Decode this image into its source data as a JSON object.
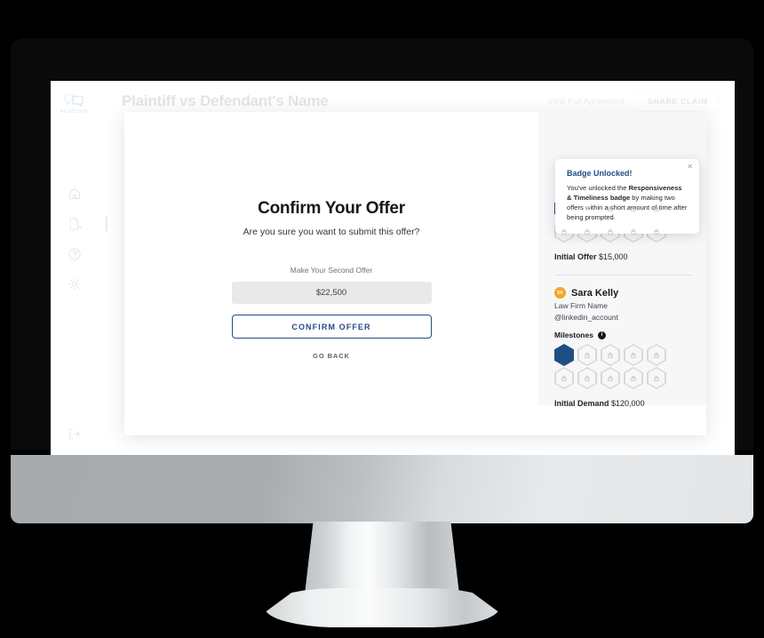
{
  "app": {
    "logo_text": "RESOLUTN",
    "logo_icon": "speech-bubbles-icon",
    "nav_arrows": "← →",
    "header": {
      "title": "Plaintiff vs Defendant's Name",
      "view_agreement_label": "View Full Agreement",
      "share_claim_label": "SHARE CLAIM"
    },
    "sidebar_items": [
      {
        "name": "home",
        "icon": "home-icon",
        "active": false
      },
      {
        "name": "new-claim",
        "icon": "document-add-icon",
        "active": true
      },
      {
        "name": "help",
        "icon": "help-circle-icon",
        "active": false
      },
      {
        "name": "settings",
        "icon": "gear-icon",
        "active": false
      }
    ],
    "logout_icon": "logout-icon"
  },
  "modal": {
    "close_icon": "close-icon",
    "title": "Confirm Your Offer",
    "subtitle": "Are you sure you want to submit this offer?",
    "offer_label": "Make Your Second Offer",
    "offer_value": "$22,500",
    "confirm_label": "CONFIRM OFFER",
    "go_back_label": "GO BACK"
  },
  "toast": {
    "close_icon": "close-icon",
    "title": "Badge Unlocked!",
    "body_prefix": "You've unlocked the ",
    "body_badge": "Responsiveness & Timeliness badge",
    "body_suffix": " by making two offers within a short amount of time after being prompted."
  },
  "side_panel": {
    "defendant": {
      "badges": [
        {
          "state": "filled",
          "icon": "upload-icon"
        },
        {
          "state": "filled",
          "icon": "clock-icon"
        },
        {
          "state": "locked",
          "icon": "lock-icon"
        },
        {
          "state": "locked",
          "icon": "lock-icon"
        },
        {
          "state": "locked",
          "icon": "lock-icon"
        },
        {
          "state": "locked",
          "icon": "lock-icon"
        },
        {
          "state": "locked",
          "icon": "lock-icon"
        },
        {
          "state": "locked",
          "icon": "lock-icon"
        },
        {
          "state": "locked",
          "icon": "lock-icon"
        },
        {
          "state": "locked",
          "icon": "lock-icon"
        }
      ],
      "stat_label": "Initial Offer",
      "stat_value": "$15,000"
    },
    "plaintiff": {
      "avatar_initials": "SK",
      "avatar_color": "#f5a623",
      "name": "Sara Kelly",
      "firm": "Law Firm Name",
      "handle": "@linkedin_account",
      "milestones_label": "Milestones",
      "info_icon": "info-icon",
      "badges": [
        {
          "state": "solid",
          "icon": "none"
        },
        {
          "state": "locked",
          "icon": "lock-icon"
        },
        {
          "state": "locked",
          "icon": "lock-icon"
        },
        {
          "state": "locked",
          "icon": "lock-icon"
        },
        {
          "state": "locked",
          "icon": "lock-icon"
        },
        {
          "state": "locked",
          "icon": "lock-icon"
        },
        {
          "state": "locked",
          "icon": "lock-icon"
        },
        {
          "state": "locked",
          "icon": "lock-icon"
        },
        {
          "state": "locked",
          "icon": "lock-icon"
        },
        {
          "state": "locked",
          "icon": "lock-icon"
        }
      ],
      "stat_label": "Initial Demand",
      "stat_value": "$120,000"
    }
  },
  "colors": {
    "accent_navy": "#1f4e85",
    "avatar_orange": "#f5a623",
    "input_gray": "#e9e9e9"
  }
}
